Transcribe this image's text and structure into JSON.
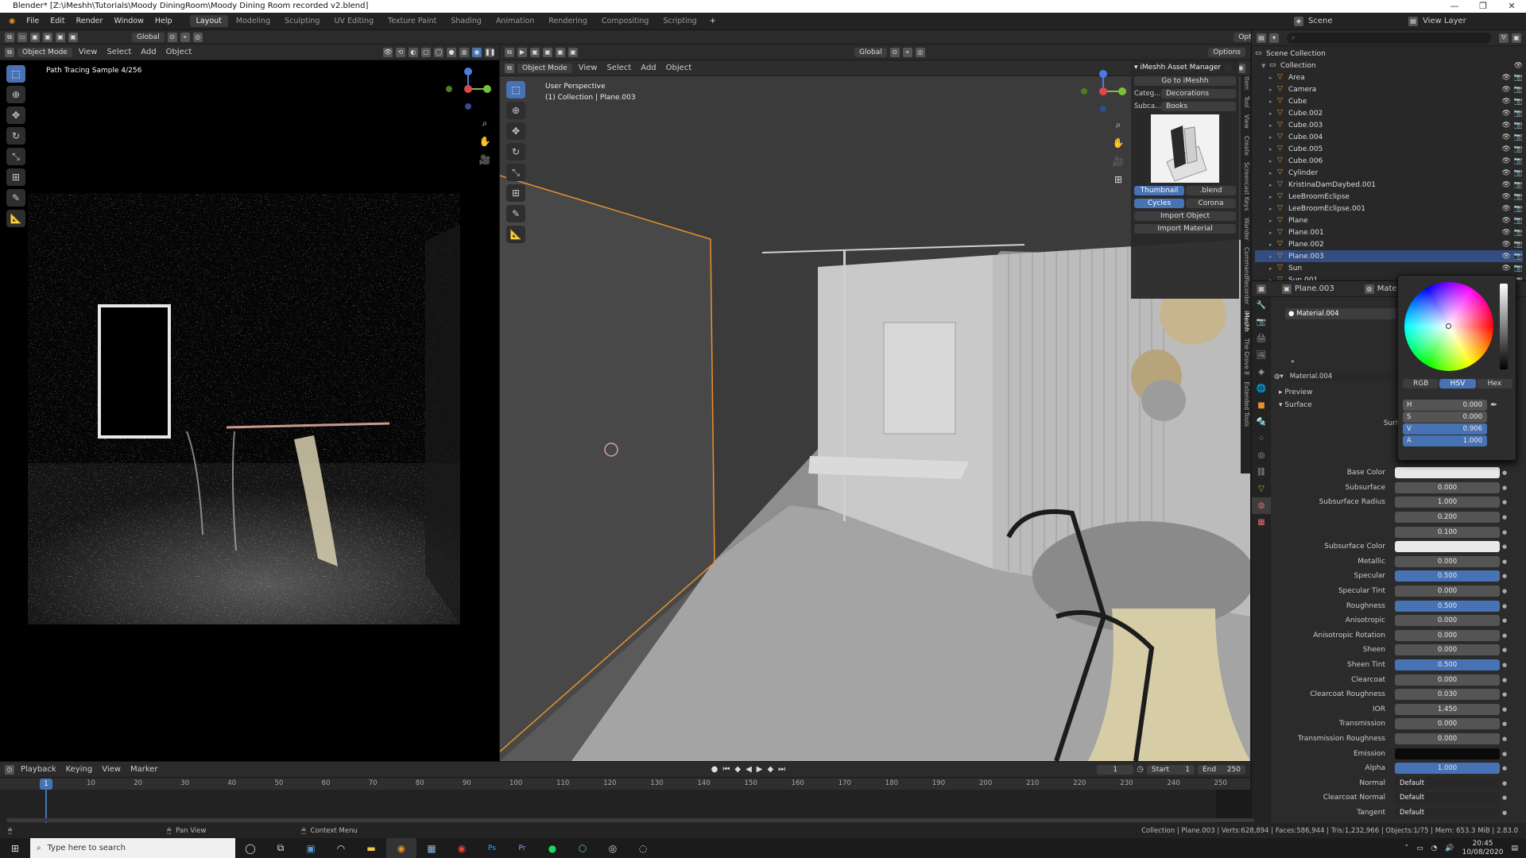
{
  "window": {
    "title": "Blender* [Z:\\iMeshh\\Tutorials\\Moody DiningRoom\\Moody Dining Room recorded v2.blend]"
  },
  "menus": [
    "File",
    "Edit",
    "Render",
    "Window",
    "Help"
  ],
  "workspaces": [
    "Layout",
    "Modeling",
    "Sculpting",
    "UV Editing",
    "Texture Paint",
    "Shading",
    "Animation",
    "Rendering",
    "Compositing",
    "Scripting"
  ],
  "active_workspace": "Layout",
  "top_header": {
    "orientation": "Global",
    "options": "Options",
    "scene": "Scene",
    "view_layer": "View Layer"
  },
  "left_viewport": {
    "mode": "Object Mode",
    "menus": [
      "View",
      "Select",
      "Add",
      "Object"
    ],
    "orientation": "Global",
    "options": "Options",
    "overlay_text": "Path Tracing Sample 4/256"
  },
  "main_viewport": {
    "mode": "Object Mode",
    "menus": [
      "View",
      "Select",
      "Add",
      "Object"
    ],
    "orientation": "Global",
    "options": "Options",
    "perspective": "User Perspective",
    "collection_info": "(1) Collection | Plane.003"
  },
  "sidebar_tabs": [
    "Item",
    "Tool",
    "View",
    "Create",
    "Screencast Keys",
    "Wander",
    "CommandRecorder",
    "iMeshh",
    "The Grove 8",
    "Extended Tools"
  ],
  "asset_manager": {
    "title": "iMeshh Asset Manager",
    "goto": "Go to iMeshh",
    "category_label": "Categ...",
    "category": "Decorations",
    "subcategory_label": "Subca...",
    "subcategory": "Books",
    "thumbnail": "Thumbnail",
    "blend": ".blend",
    "engine_cycles": "Cycles",
    "engine_corona": "Corona",
    "import_object": "Import Object",
    "import_material": "Import Material"
  },
  "outliner": {
    "root": "Scene Collection",
    "collection": "Collection",
    "items": [
      "Area",
      "Camera",
      "Cube",
      "Cube.002",
      "Cube.003",
      "Cube.004",
      "Cube.005",
      "Cube.006",
      "Cylinder",
      "KristinaDamDaybed.001",
      "LeeBroomEclipse",
      "LeeBroomEclipse.001",
      "Plane",
      "Plane.001",
      "Plane.002",
      "Plane.003",
      "Sun",
      "Sun.001"
    ],
    "selected": "Plane.003"
  },
  "properties": {
    "object": "Plane.003",
    "material_tab": "Material.004",
    "slot": "Material.004",
    "material": "Material.004",
    "preview": "Preview",
    "surface_header": "Surface",
    "surface_label": "Surface",
    "rows": [
      {
        "label": "Base Color",
        "value": "",
        "kind": "white"
      },
      {
        "label": "Subsurface",
        "value": "0.000",
        "kind": "num"
      },
      {
        "label": "Subsurface Radius",
        "value": "1.000",
        "kind": "num"
      },
      {
        "label": "",
        "value": "0.200",
        "kind": "num"
      },
      {
        "label": "",
        "value": "0.100",
        "kind": "num"
      },
      {
        "label": "Subsurface Color",
        "value": "",
        "kind": "white"
      },
      {
        "label": "Metallic",
        "value": "0.000",
        "kind": "num"
      },
      {
        "label": "Specular",
        "value": "0.500",
        "kind": "blue"
      },
      {
        "label": "Specular Tint",
        "value": "0.000",
        "kind": "num"
      },
      {
        "label": "Roughness",
        "value": "0.500",
        "kind": "blue"
      },
      {
        "label": "Anisotropic",
        "value": "0.000",
        "kind": "num"
      },
      {
        "label": "Anisotropic Rotation",
        "value": "0.000",
        "kind": "num"
      },
      {
        "label": "Sheen",
        "value": "0.000",
        "kind": "num"
      },
      {
        "label": "Sheen Tint",
        "value": "0.500",
        "kind": "blue"
      },
      {
        "label": "Clearcoat",
        "value": "0.000",
        "kind": "num"
      },
      {
        "label": "Clearcoat Roughness",
        "value": "0.030",
        "kind": "num"
      },
      {
        "label": "IOR",
        "value": "1.450",
        "kind": "num"
      },
      {
        "label": "Transmission",
        "value": "0.000",
        "kind": "num"
      },
      {
        "label": "Transmission Roughness",
        "value": "0.000",
        "kind": "num"
      },
      {
        "label": "Emission",
        "value": "",
        "kind": "black"
      },
      {
        "label": "Alpha",
        "value": "1.000",
        "kind": "blue"
      },
      {
        "label": "Normal",
        "value": "Default",
        "kind": "text"
      },
      {
        "label": "Clearcoat Normal",
        "value": "Default",
        "kind": "text"
      },
      {
        "label": "Tangent",
        "value": "Default",
        "kind": "text"
      }
    ]
  },
  "color_picker": {
    "modes": [
      "RGB",
      "HSV",
      "Hex"
    ],
    "active_mode": "HSV",
    "h": "0.000",
    "s": "0.000",
    "v": "0.906",
    "a": "1.000",
    "h_label": "H",
    "s_label": "S",
    "v_label": "V",
    "a_label": "A"
  },
  "timeline": {
    "menus": [
      "Playback",
      "Keying",
      "View",
      "Marker"
    ],
    "current_frame": "1",
    "start_label": "Start",
    "start": "1",
    "end_label": "End",
    "end": "250",
    "ticks": [
      "10",
      "20",
      "30",
      "40",
      "50",
      "60",
      "70",
      "80",
      "90",
      "100",
      "110",
      "120",
      "130",
      "140",
      "150",
      "160",
      "170",
      "180",
      "190",
      "200",
      "210",
      "220",
      "230",
      "240",
      "250"
    ]
  },
  "statusbar": {
    "pan": "Pan View",
    "context": "Context Menu",
    "info": "Collection | Plane.003 | Verts:628,894 | Faces:586,944 | Tris:1,232,966 | Objects:1/75 | Mem: 653.3 MiB | 2.83.0"
  },
  "taskbar": {
    "search_placeholder": "Type here to search",
    "time": "20:45",
    "date": "10/08/2020"
  },
  "colors": {
    "accent": "#4772b3",
    "selection_outline": "#e8912d",
    "bg": "#1d1d1d"
  }
}
